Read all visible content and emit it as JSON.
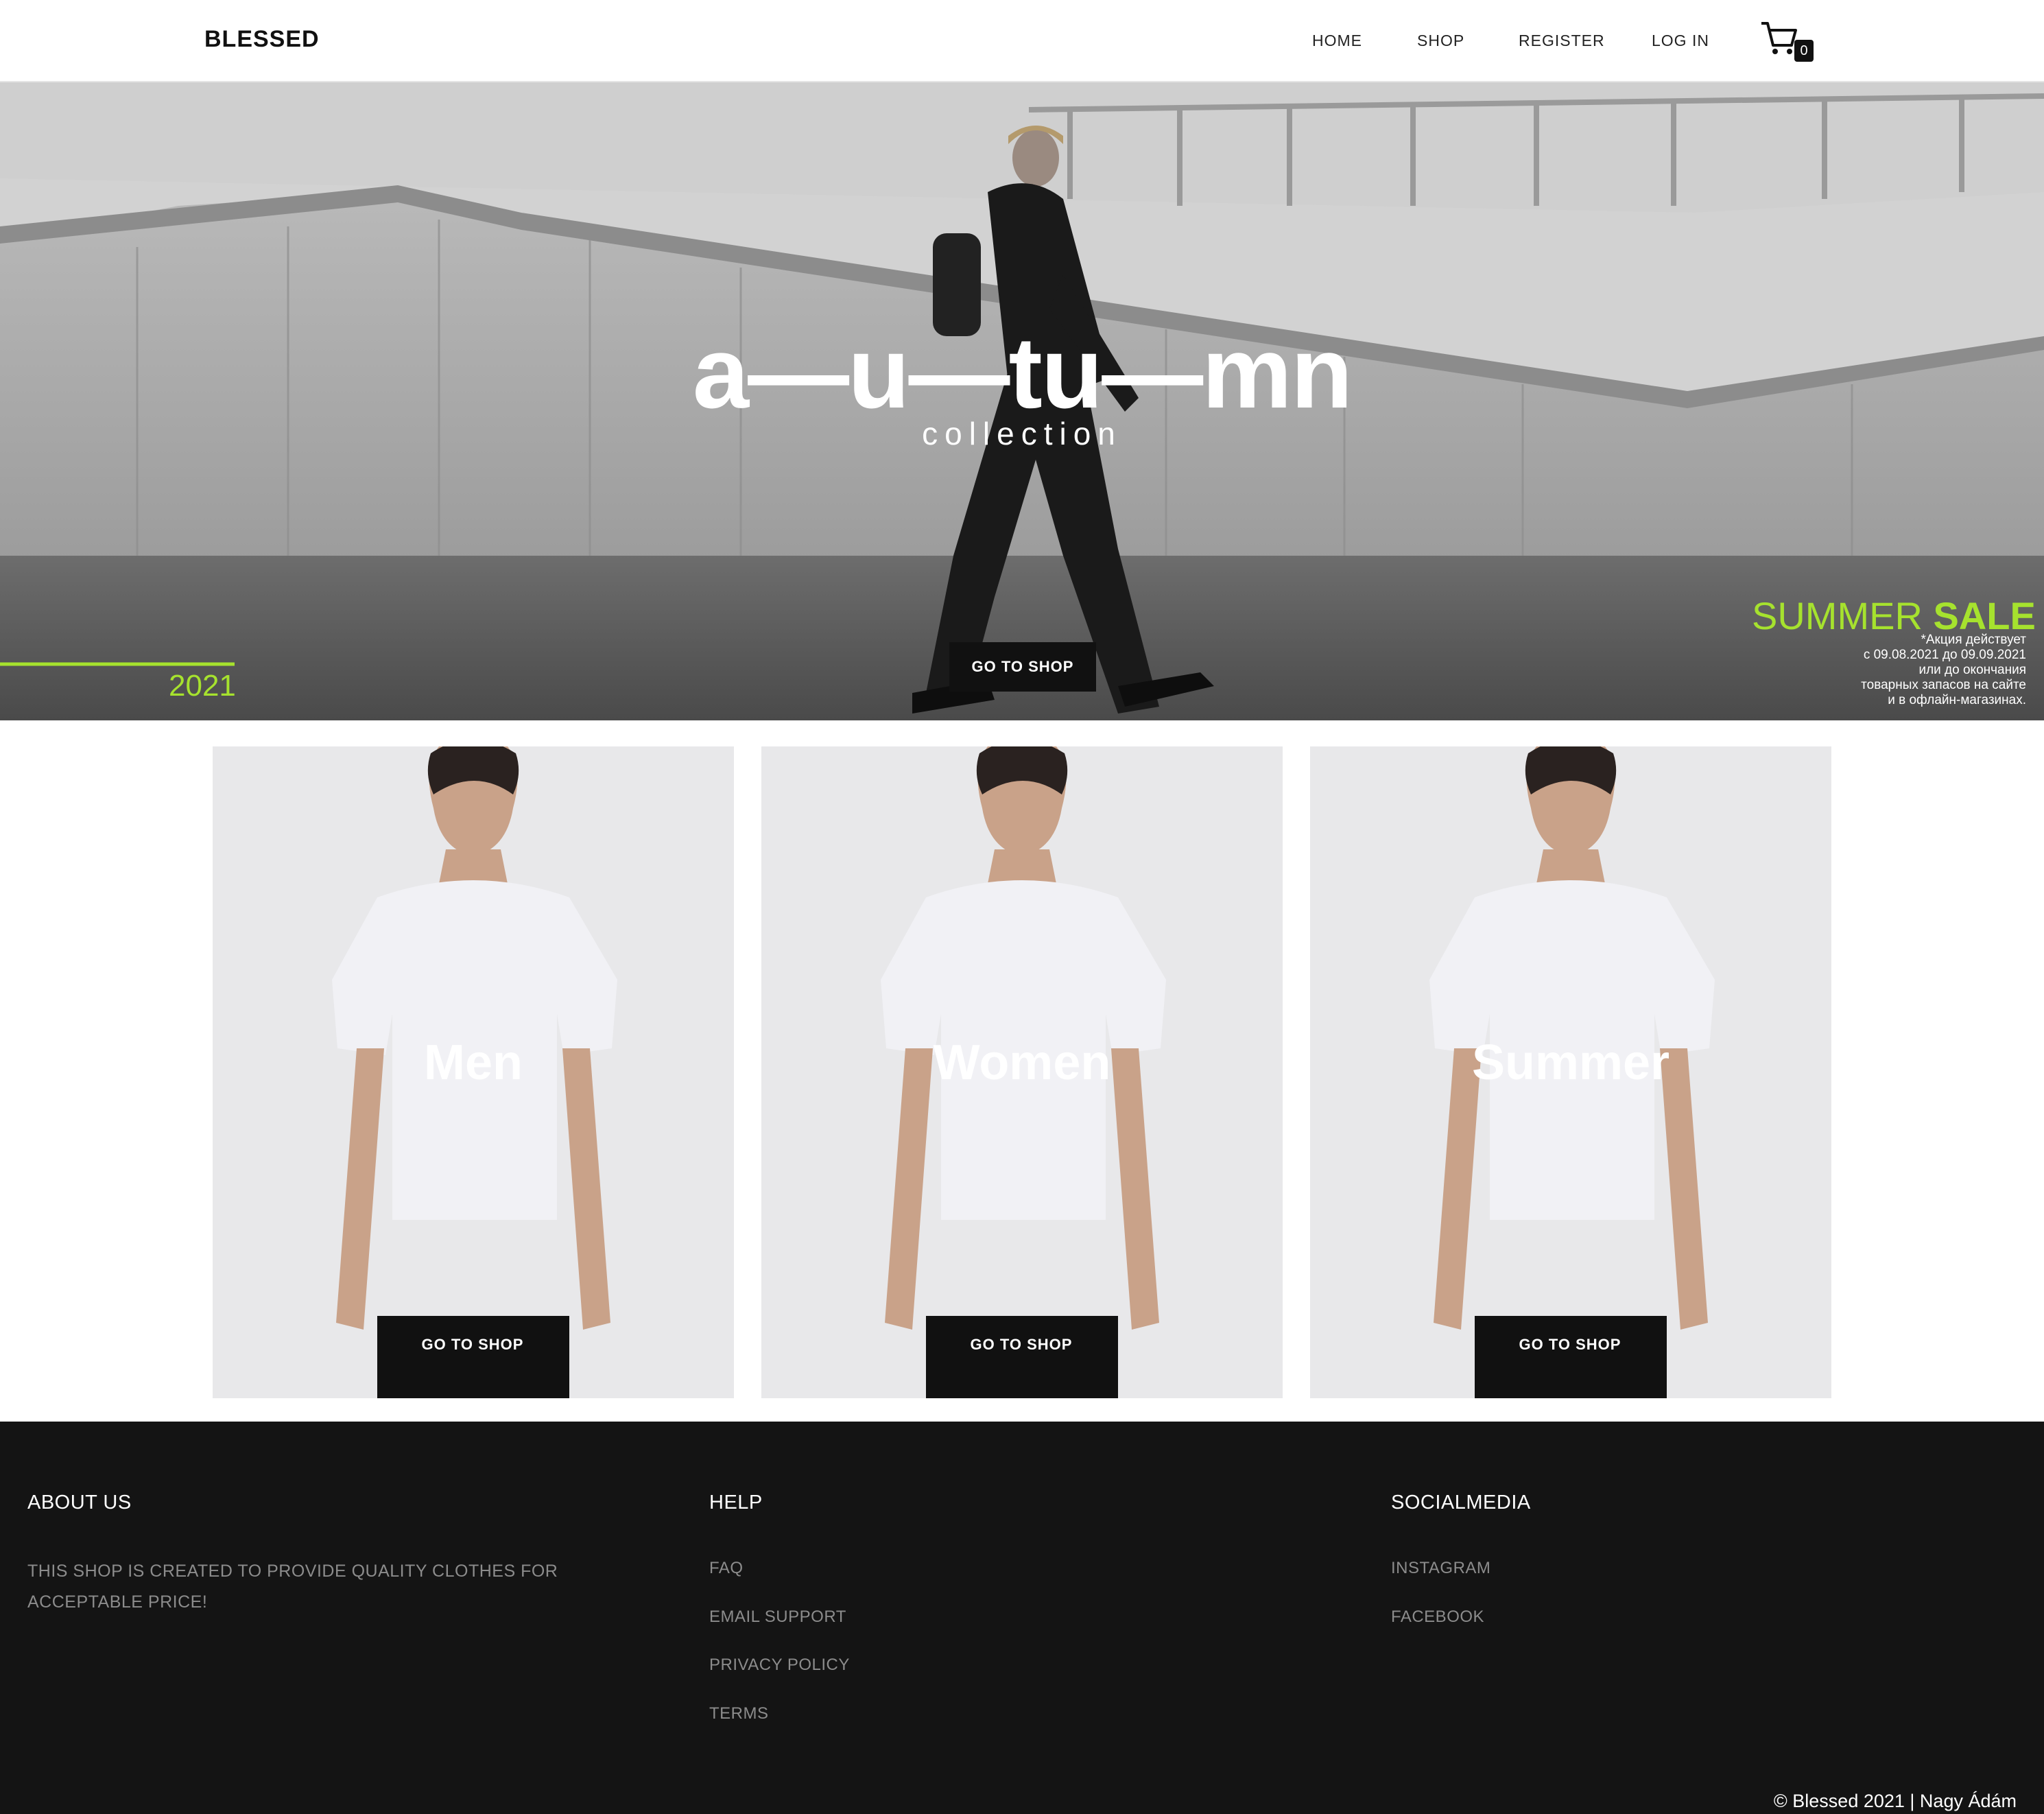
{
  "navbar": {
    "brand": "BLESSED",
    "links": [
      "HOME",
      "SHOP",
      "REGISTER",
      "LOG IN"
    ],
    "cart_icon": "shopping-cart-icon",
    "cart_count": "0"
  },
  "hero": {
    "title": "a—u—tu—mn",
    "subtitle": "collection",
    "button": "GO TO SHOP",
    "year": "2021",
    "sale_light": "SUMMER",
    "sale_bold": "SALE",
    "sale_note": [
      "*Акция действует",
      "с 09.08.2021 до 09.09.2021",
      "или до окончания",
      "товарных запасов на сайте",
      "и в офлайн-магазинах."
    ],
    "accent_color": "#a6e22e"
  },
  "categories": [
    {
      "title": "Men",
      "button": "GO TO SHOP"
    },
    {
      "title": "Women",
      "button": "GO TO SHOP"
    },
    {
      "title": "Summer",
      "button": "GO TO SHOP"
    }
  ],
  "footer": {
    "about": {
      "heading": "ABOUT US",
      "text": "THIS SHOP IS CREATED TO PROVIDE QUALITY CLOTHES FOR ACCEPTABLE PRICE!"
    },
    "help": {
      "heading": "HELP",
      "links": [
        "FAQ",
        "EMAIL SUPPORT",
        "PRIVACY POLICY",
        "TERMS"
      ]
    },
    "social": {
      "heading": "SOCIALMEDIA",
      "links": [
        "INSTAGRAM",
        "FACEBOOK"
      ]
    },
    "copyright": "© Blessed 2021 | Nagy Ádám"
  }
}
